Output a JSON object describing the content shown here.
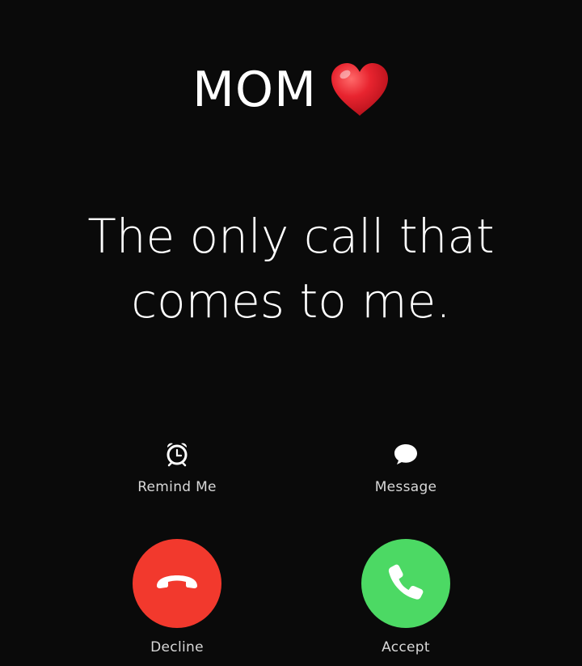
{
  "caller": {
    "name": "MOM",
    "emoji_icon": "red-heart-icon",
    "heart_color": "#e8242f"
  },
  "tagline": {
    "line1": "The only call that",
    "line2": "comes to me."
  },
  "options": {
    "remind": {
      "label": "Remind Me",
      "icon": "alarm-clock-icon"
    },
    "message": {
      "label": "Message",
      "icon": "speech-bubble-icon"
    }
  },
  "actions": {
    "decline": {
      "label": "Decline",
      "icon": "phone-hangup-icon",
      "color": "#f2392d"
    },
    "accept": {
      "label": "Accept",
      "icon": "phone-icon",
      "color": "#4cd964"
    }
  }
}
